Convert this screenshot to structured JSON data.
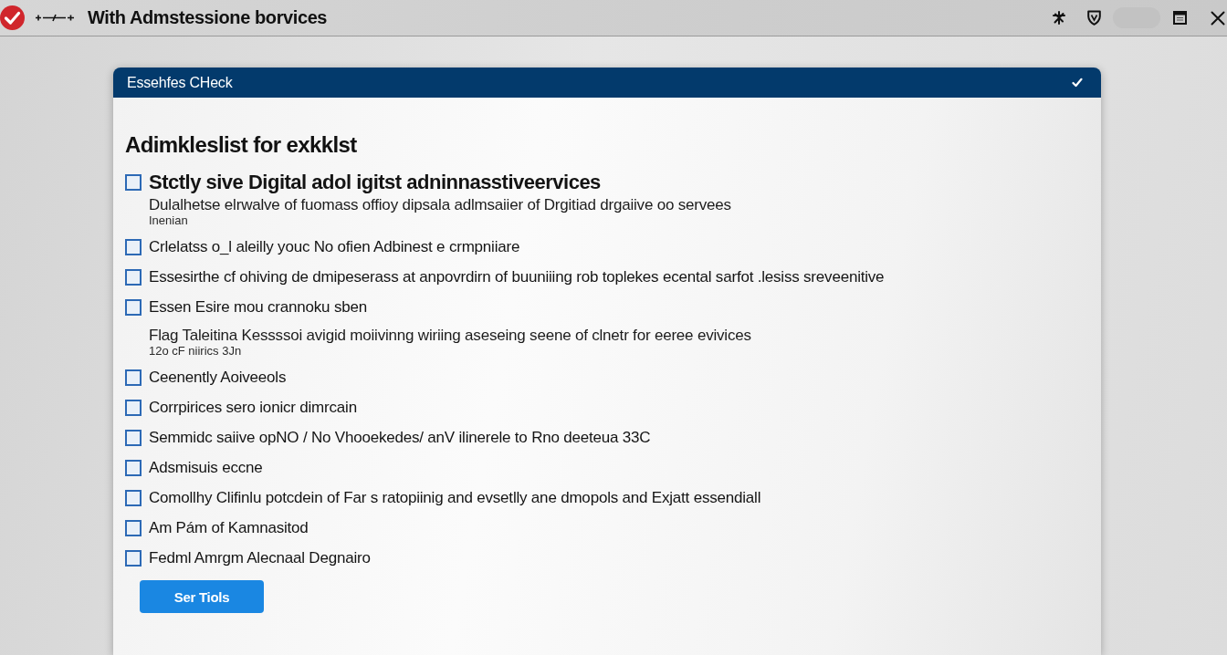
{
  "title_bar": {
    "title": "With Admstessione borvices"
  },
  "panel": {
    "header": "Essehfes CHeck",
    "heading": "Adimkleslist for exkklst",
    "items": [
      {
        "kind": "primary",
        "label": "Stctly sive Digital adol igitst adninnasstiveervices",
        "checked": false,
        "description": "Dulalhetse elrwalve of fuomass offioy dipsala adlmsaiier of Drgitiad drgaiive oo servees",
        "note": "Inenian"
      },
      {
        "kind": "plain",
        "label": "Crlelatss o_l aleilly youc No ofien Adbinest e crmpniiare",
        "checked": false
      },
      {
        "kind": "plain",
        "label": "Essesirthe cf ohiving de dmipeserass at anpovrdirn of buuniiing rob toplekes ecental sarfot .lesiss sreveenitive",
        "checked": false
      },
      {
        "kind": "plain",
        "label": "Essen Esire mou crannoku sben",
        "checked": false,
        "description": "Flag Taleitina Kessssoi avigid moiivinng wiriing aseseing seene of clnetr for eeree evivices",
        "note": "12o cF niirics 3Jn"
      },
      {
        "kind": "plain",
        "label": "Ceenently Aoiveeols",
        "checked": false
      },
      {
        "kind": "plain",
        "label": "Corrpirices sero ionicr dimrcain",
        "checked": false
      },
      {
        "kind": "plain",
        "label": "Semmidc saiive opNO / No Vhooekedes/ anV ilinerele to Rno deeteua 33C",
        "checked": false
      },
      {
        "kind": "plain",
        "label": "Adsmisuis eccne",
        "checked": false
      },
      {
        "kind": "plain",
        "label": "Comollhy Clifinlu potcdein of Far s ratopiinig and evsetlly ane dmopols and Exjatt essendiall",
        "checked": false
      },
      {
        "kind": "plain",
        "label": "Am Pám of Kamnasitod",
        "checked": false
      },
      {
        "kind": "plain",
        "label": "Fedml Amrgm Alecnaal Degnairo",
        "checked": false
      }
    ],
    "button": "Ser Tiols"
  }
}
